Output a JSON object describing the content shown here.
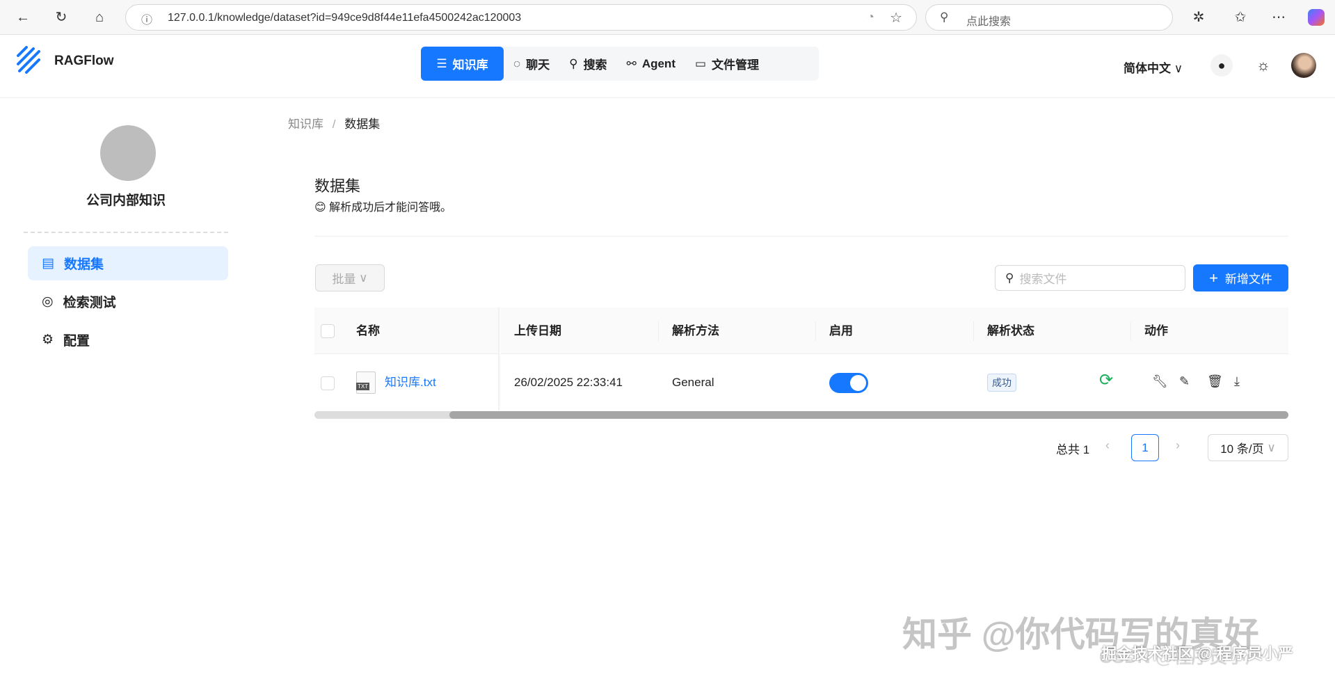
{
  "browser": {
    "url": "127.0.0.1/knowledge/dataset?id=949ce9d8f44e11efa4500242ac120003",
    "search_placeholder": "点此搜索"
  },
  "app": {
    "logo": "RAGFlow",
    "nav": [
      {
        "label": "知识库",
        "active": true
      },
      {
        "label": "聊天"
      },
      {
        "label": "搜索"
      },
      {
        "label": "Agent"
      },
      {
        "label": "文件管理"
      }
    ],
    "language": "简体中文"
  },
  "sidebar": {
    "kb_name": "公司内部知识",
    "items": [
      {
        "label": "数据集",
        "active": true
      },
      {
        "label": "检索测试"
      },
      {
        "label": "配置"
      }
    ]
  },
  "breadcrumb": [
    "知识库",
    "数据集"
  ],
  "main": {
    "title": "数据集",
    "subtitle": "解析成功后才能问答哦。",
    "batch_label": "批量",
    "search_placeholder": "搜索文件",
    "add_label": "新增文件",
    "columns": [
      "名称",
      "上传日期",
      "解析方法",
      "启用",
      "解析状态",
      "动作"
    ],
    "rows": [
      {
        "name": "知识库.txt",
        "date": "26/02/2025 22:33:41",
        "method": "General",
        "enabled": true,
        "status": "成功",
        "file_type": "TXT"
      }
    ],
    "pagination": {
      "total": "总共 1",
      "page": "1",
      "page_size": "10 条/页"
    }
  },
  "watermarks": [
    "知乎 @你代码写的真好",
    "掘金技术社区 @ 程序员小严",
    "CSDN @程序员小严"
  ],
  "colors": {
    "primary": "#1677ff",
    "success": "#1aaf5d"
  }
}
